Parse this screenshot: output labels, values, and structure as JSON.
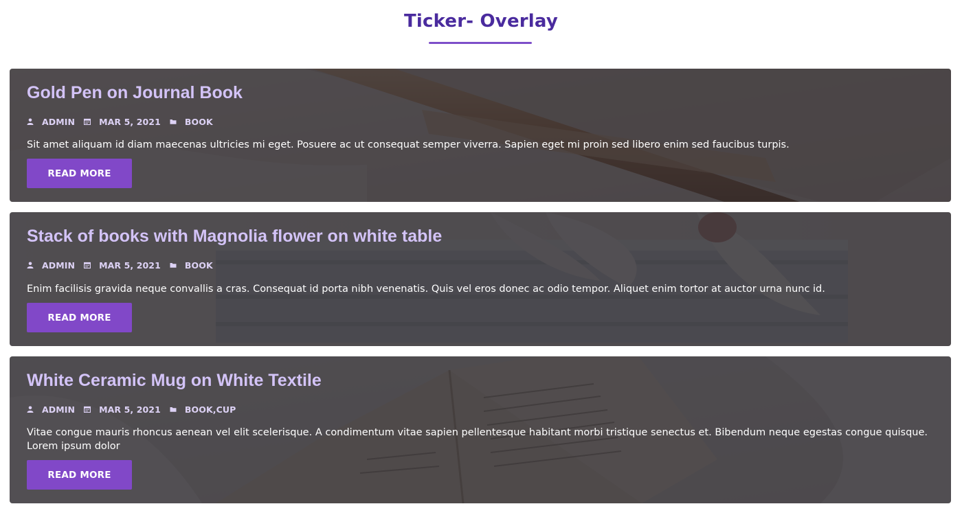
{
  "page": {
    "title": "Ticker- Overlay"
  },
  "colors": {
    "title": "#4a2b9e",
    "accent": "#8148c8",
    "post_title": "#d3c3f7"
  },
  "posts": [
    {
      "title": "Gold Pen on Journal Book",
      "author": "ADMIN",
      "date": "MAR 5, 2021",
      "categories": [
        "BOOK"
      ],
      "excerpt": "Sit amet aliquam id diam maecenas ultricies mi eget. Posuere ac ut consequat semper viverra. Sapien eget mi proin sed libero enim sed faucibus turpis.",
      "button_label": "READ MORE",
      "background": "gold-pen-on-journal-photo"
    },
    {
      "title": "Stack of books with Magnolia flower on white table",
      "author": "ADMIN",
      "date": "MAR 5, 2021",
      "categories": [
        "BOOK"
      ],
      "excerpt": "Enim facilisis gravida neque convallis a cras. Consequat id porta nibh venenatis. Quis vel eros donec ac odio tempor. Aliquet enim tortor at auctor urna nunc id.",
      "button_label": "READ MORE",
      "background": "books-with-magnolia-photo"
    },
    {
      "title": "White Ceramic Mug on White Textile",
      "author": "ADMIN",
      "date": "MAR 5, 2021",
      "categories": [
        "BOOK",
        "CUP"
      ],
      "category_separator": ",",
      "excerpt": "Vitae congue mauris rhoncus aenean vel elit scelerisque. A condimentum vitae sapien pellentesque habitant morbi tristique senectus et. Bibendum neque egestas congue quisque. Lorem ipsum dolor",
      "button_label": "READ MORE",
      "background": "open-book-photo"
    }
  ],
  "icons": {
    "author": "user-icon",
    "date": "calendar-icon",
    "category": "folder-icon"
  }
}
